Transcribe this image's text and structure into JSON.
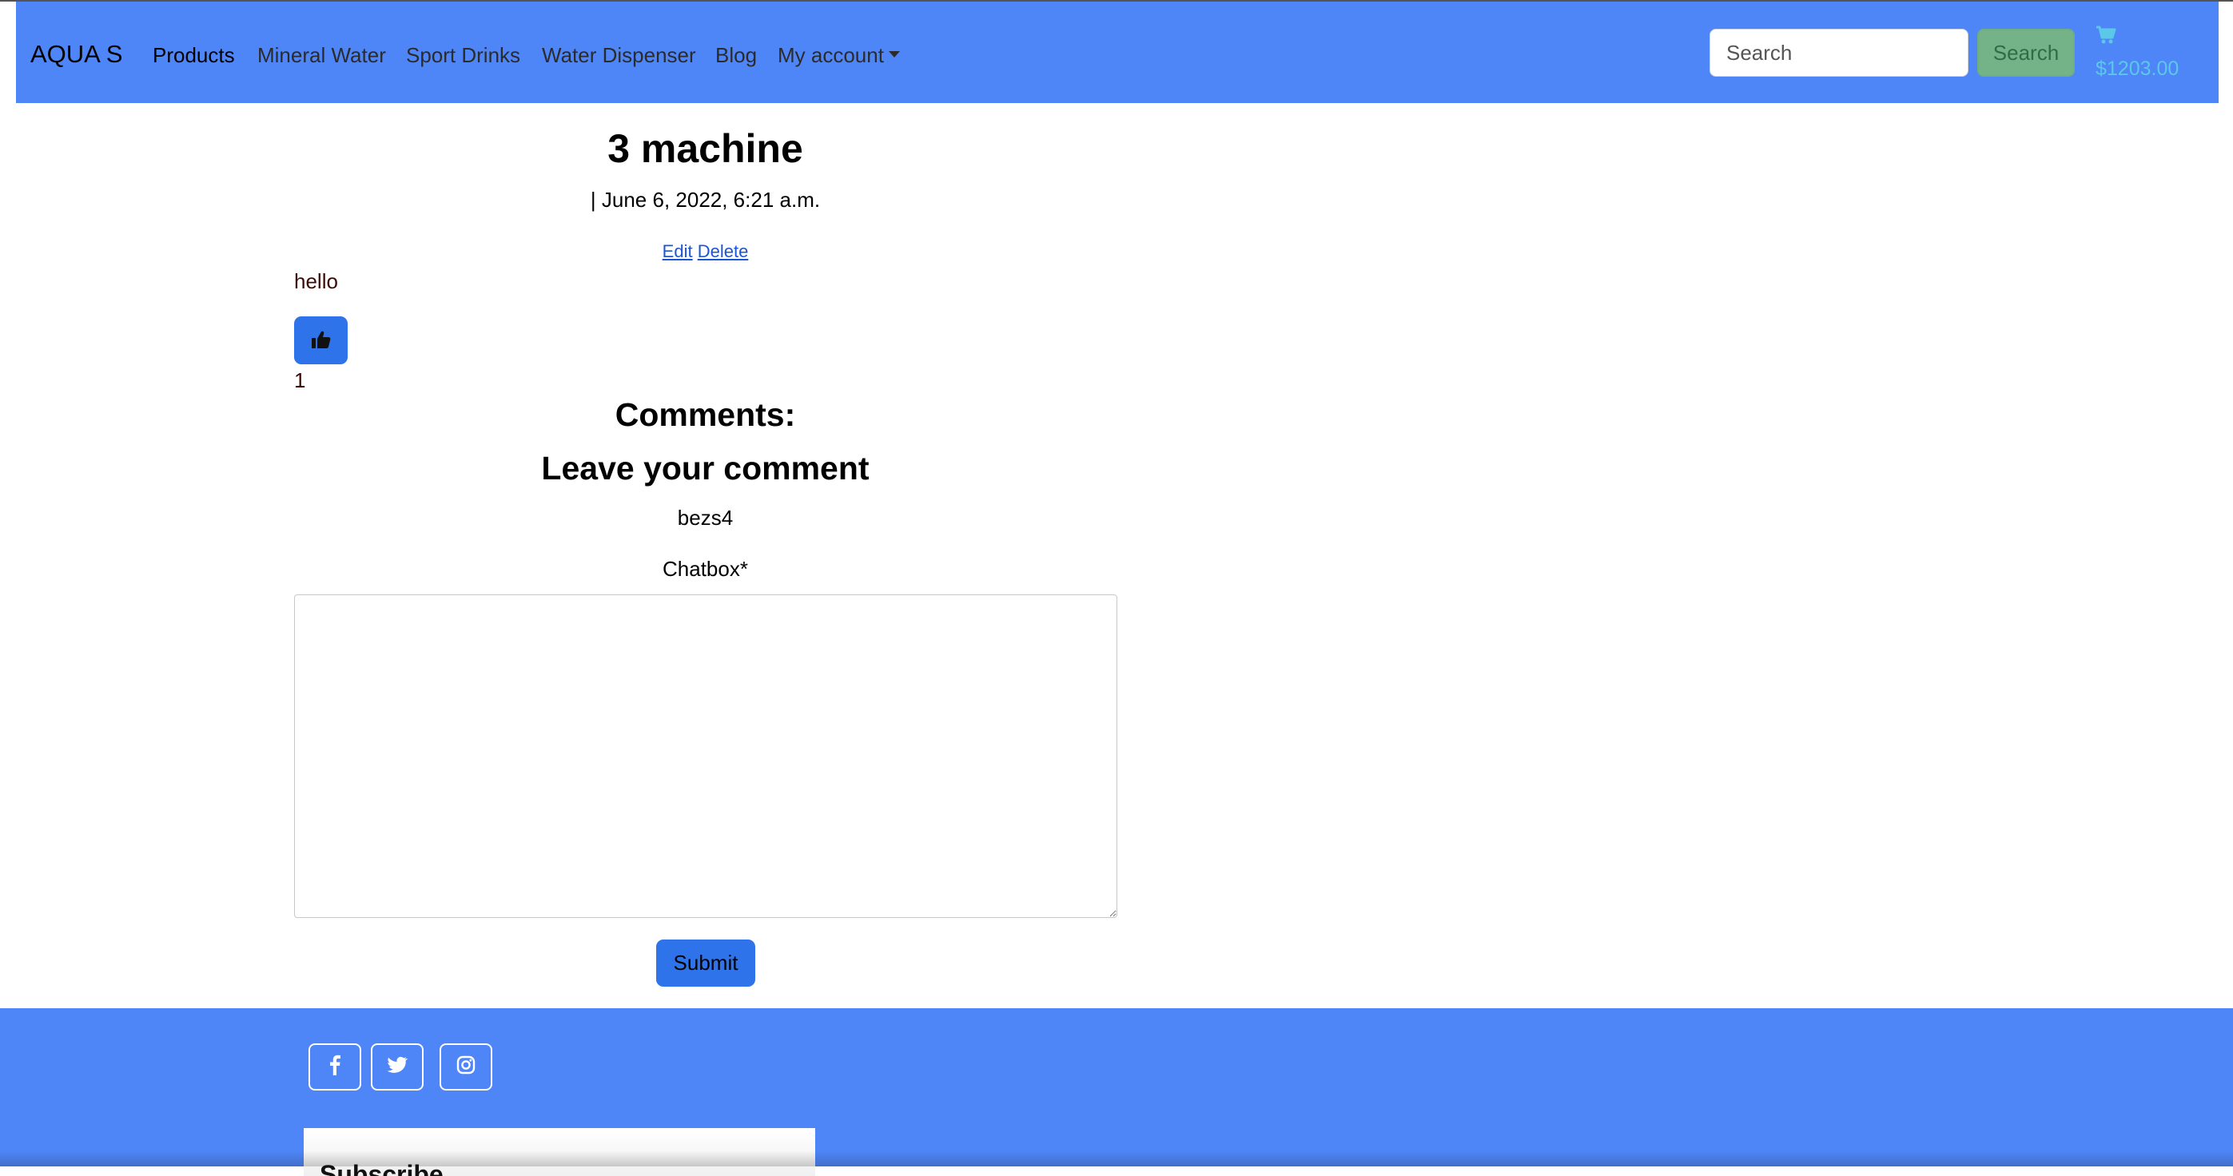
{
  "navbar": {
    "brand": "AQUA S",
    "items": [
      {
        "label": "Products"
      },
      {
        "label": "Mineral Water"
      },
      {
        "label": "Sport Drinks"
      },
      {
        "label": "Water Dispenser"
      },
      {
        "label": "Blog"
      },
      {
        "label": "My account"
      }
    ],
    "search": {
      "placeholder": "Search",
      "button_label": "Search"
    },
    "cart": {
      "total": "$1203.00"
    }
  },
  "post": {
    "title": "3 machine",
    "date": "| June 6, 2022, 6:21 a.m.",
    "edit_label": "Edit",
    "delete_label": "Delete",
    "body": "hello",
    "like_count": "1"
  },
  "comments": {
    "heading": "Comments:",
    "form_heading": "Leave your comment",
    "username": "bezs4",
    "chatbox_label": "Chatbox*",
    "chatbox_value": "",
    "submit_label": "Submit"
  },
  "footer": {
    "social_icons": [
      "facebook-icon",
      "twitter-icon",
      "instagram-icon"
    ],
    "subscribe_title": "Subscribe"
  },
  "colors": {
    "navbar_bg": "#4f86f7",
    "footer_bg": "#4f86f7",
    "primary_button": "#2f73ea",
    "search_button": "#74b387",
    "cart_color": "#5bc8e8"
  }
}
